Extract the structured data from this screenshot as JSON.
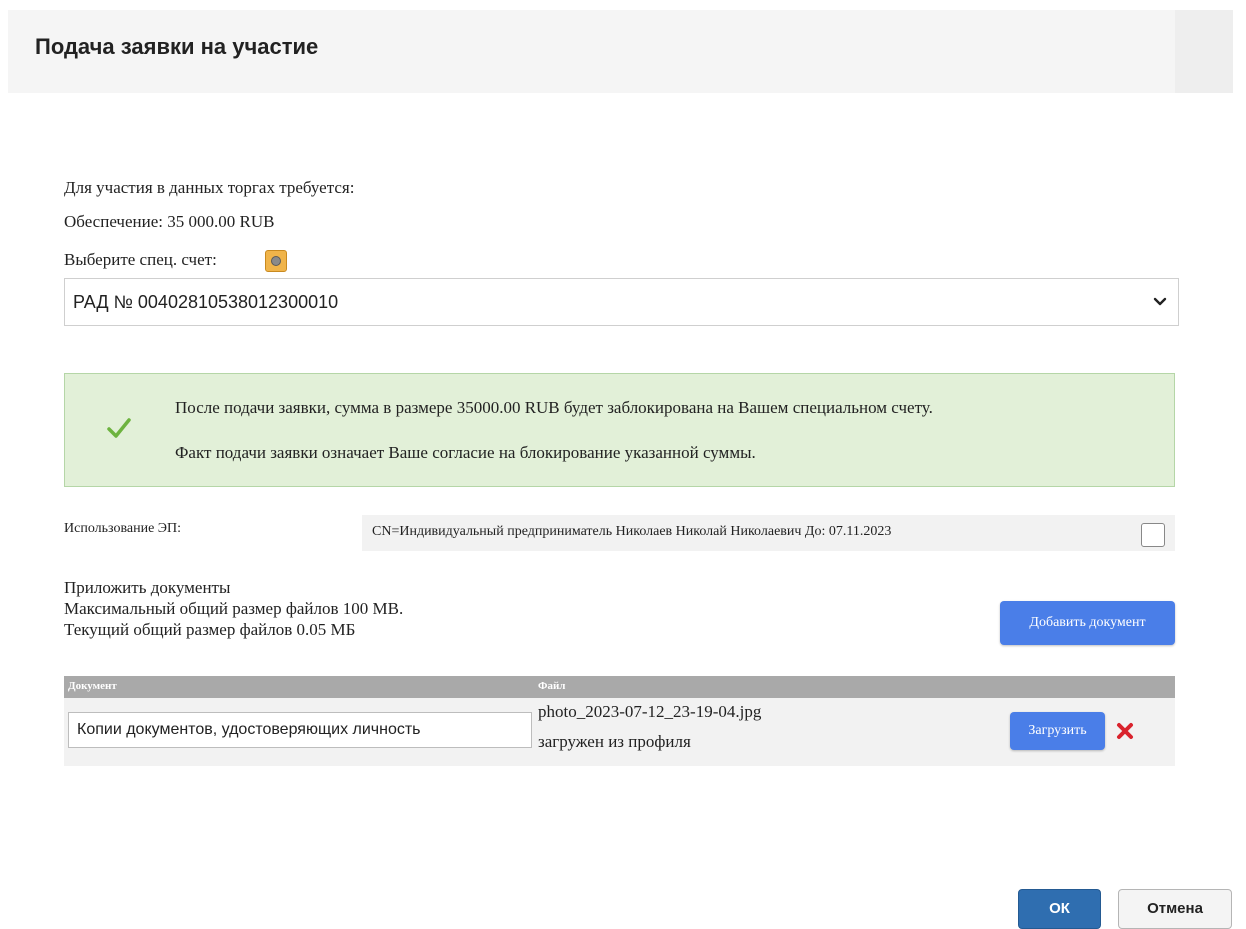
{
  "dialog": {
    "title": "Подача заявки на участие"
  },
  "requirements": {
    "intro": "Для участия в данных торгах требуется:",
    "deposit_label": "Обеспечение:",
    "deposit_value": "35 000.00 RUB",
    "account_label": "Выберите спец. счет:",
    "account_help_icon": "help-icon"
  },
  "account_select": {
    "selected": "РАД № 00402810538012300010",
    "chevron_icon": "chevron-down-icon"
  },
  "notice": {
    "icon": "check-icon",
    "color": "#e2f0d8",
    "line1": "После подачи заявки, сумма в размере 35000.00 RUB будет заблокирована на Вашем специальном счету.",
    "line2": "Факт подачи заявки означает Ваше согласие на блокирование указанной суммы."
  },
  "signature": {
    "label": "Использование ЭП:",
    "certificate": "CN=Индивидуальный предприниматель Николаев Николай Николаевич До: 07.11.2023",
    "checked": false
  },
  "attachments": {
    "heading": "Приложить документы",
    "max_size": "Максимальный общий размер файлов 100 MB.",
    "current_size": "Текущий общий размер файлов 0.05 МБ",
    "add_button": "Добавить документ",
    "columns": [
      "Документ",
      "Файл"
    ],
    "rows": [
      {
        "document": "Копии документов, удостоверяющих личность",
        "file_name": "photo_2023-07-12_23-19-04.jpg",
        "file_source": "загружен из профиля",
        "upload_button": "Загрузить",
        "delete_icon": "delete-icon"
      }
    ]
  },
  "footer": {
    "ok_button": "ОК",
    "cancel_button": "Отмена"
  },
  "colors": {
    "primary_button": "#4a7ee8",
    "ok_button": "#2f6eb0",
    "delete_icon": "#d9232d",
    "check_icon": "#6db33f"
  }
}
